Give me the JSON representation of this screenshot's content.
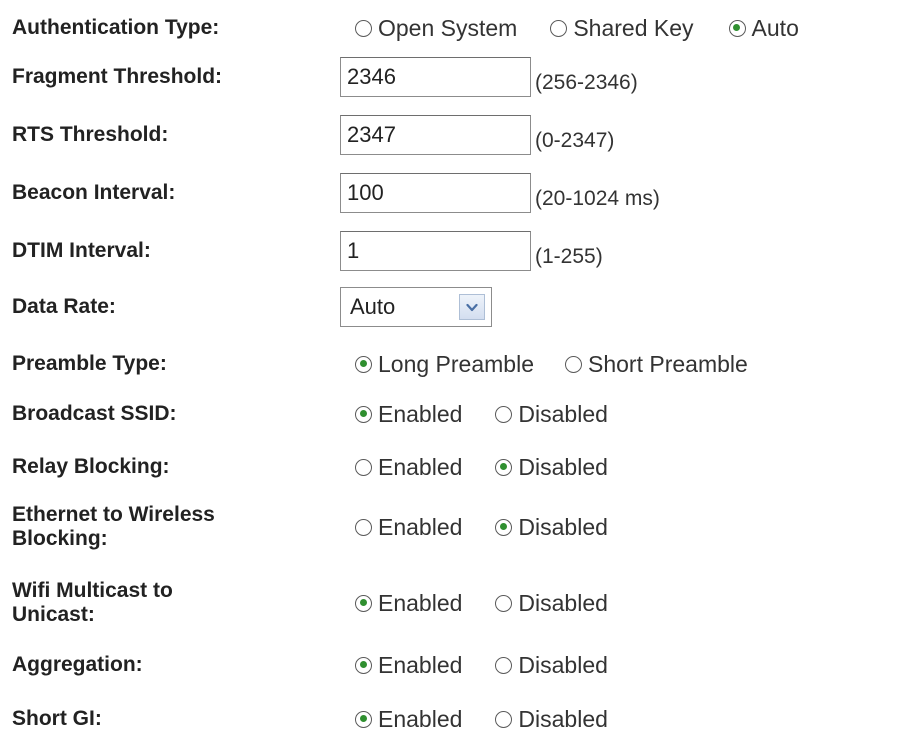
{
  "rows": [
    {
      "label": "Authentication Type:",
      "options": [
        "Open System",
        "Shared Key",
        "Auto"
      ],
      "selected": "Auto"
    },
    {
      "label": "Fragment Threshold:",
      "value": "2346",
      "range": "(256-2346)"
    },
    {
      "label": "RTS Threshold:",
      "value": "2347",
      "range": "(0-2347)"
    },
    {
      "label": "Beacon Interval:",
      "value": "100",
      "range": "(20-1024 ms)"
    },
    {
      "label": "DTIM Interval:",
      "value": "1",
      "range": "(1-255)"
    },
    {
      "label": "Data Rate:",
      "selected": "Auto"
    },
    {
      "label": "Preamble Type:",
      "options": [
        "Long Preamble",
        "Short Preamble"
      ],
      "selected": "Long Preamble"
    },
    {
      "label": "Broadcast SSID:",
      "options": [
        "Enabled",
        "Disabled"
      ],
      "selected": "Enabled"
    },
    {
      "label": "Relay Blocking:",
      "options": [
        "Enabled",
        "Disabled"
      ],
      "selected": "Disabled"
    },
    {
      "label": "Ethernet to Wireless Blocking:",
      "label_lines": [
        "Ethernet to Wireless",
        "Blocking:"
      ],
      "options": [
        "Enabled",
        "Disabled"
      ],
      "selected": "Disabled"
    },
    {
      "label": "Wifi Multicast to Unicast:",
      "label_lines": [
        "Wifi Multicast to",
        "Unicast:"
      ],
      "options": [
        "Enabled",
        "Disabled"
      ],
      "selected": "Enabled"
    },
    {
      "label": "Aggregation:",
      "options": [
        "Enabled",
        "Disabled"
      ],
      "selected": "Enabled"
    },
    {
      "label": "Short GI:",
      "options": [
        "Enabled",
        "Disabled"
      ],
      "selected": "Enabled"
    }
  ],
  "icons": {
    "radio_checked": "radio-checked-icon",
    "radio_unchecked": "radio-unchecked-icon",
    "dropdown": "chevron-down-icon"
  },
  "colors": {
    "radio_dot": "#2f8f2f",
    "label_text": "#222222",
    "dropdown_arrow": "#4a6fa5"
  }
}
